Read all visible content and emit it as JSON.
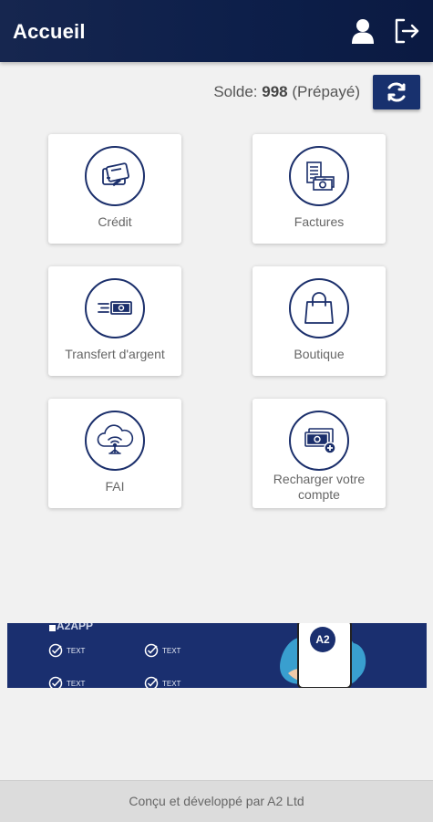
{
  "appbar": {
    "title": "Accueil",
    "user_icon": "user-icon",
    "logout_icon": "logout-icon"
  },
  "balance": {
    "label": "Solde: ",
    "amount": "998",
    "type": " (Prépayé)",
    "refresh_icon": "refresh-icon"
  },
  "tiles": [
    {
      "label": "Crédit",
      "icon": "credit-card-icon"
    },
    {
      "label": "Factures",
      "icon": "bills-icon"
    },
    {
      "label": "Transfert d'argent",
      "icon": "money-transfer-icon"
    },
    {
      "label": "Boutique",
      "icon": "shopping-bag-icon"
    },
    {
      "label": "FAI",
      "icon": "cloud-wifi-icon"
    },
    {
      "label": "Recharger votre compte",
      "icon": "recharge-money-icon"
    }
  ],
  "banner": {
    "brand": "A2APP",
    "items": [
      "TEXT",
      "TEXT",
      "TEXT",
      "TEXT"
    ],
    "phone_logo": "A2"
  },
  "footer": {
    "text": "Conçu et développé par A2 Ltd"
  },
  "colors": {
    "primary": "#18316e",
    "appbar": "#0d1f4a",
    "background": "#f1f1f1"
  }
}
